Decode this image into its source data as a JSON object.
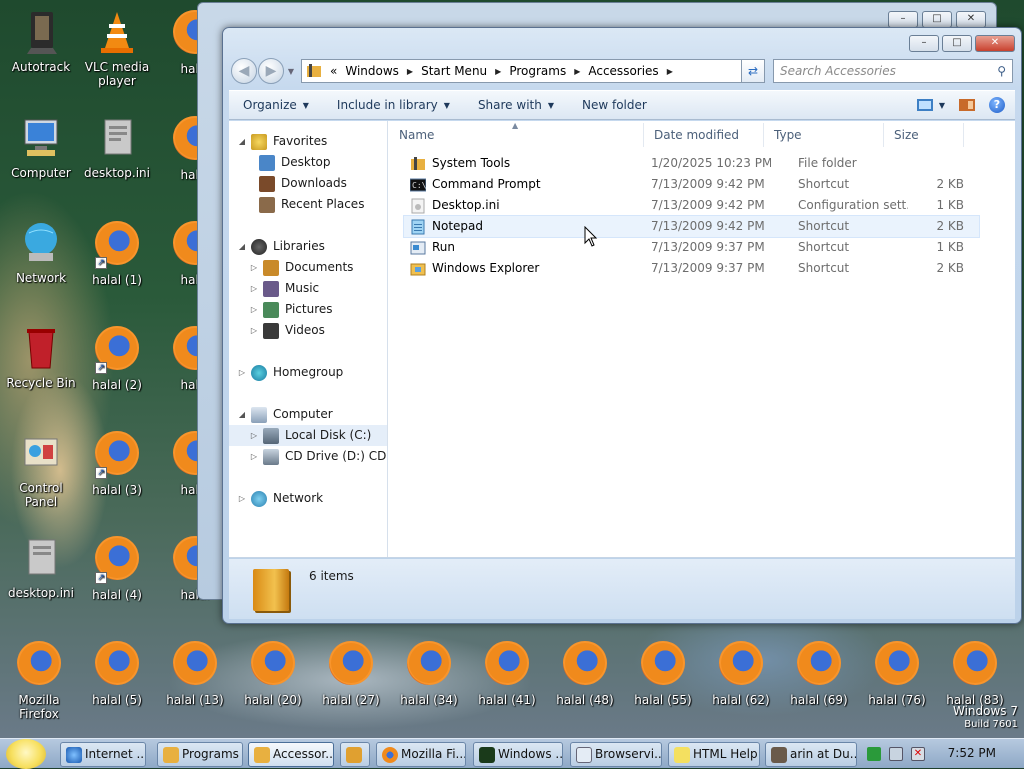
{
  "desktop": {
    "icons_left": [
      {
        "label": "Autotrack",
        "icon": "autotrack-icon"
      },
      {
        "label": "VLC media player",
        "icon": "vlc-cone-icon"
      },
      {
        "label": "Computer",
        "icon": "computer-icon"
      },
      {
        "label": "desktop.ini",
        "icon": "ini-file-icon"
      },
      {
        "label": "Network",
        "icon": "network-globe-icon"
      },
      {
        "label": "halal (1)",
        "icon": "firefox-icon"
      },
      {
        "label": "Recycle Bin",
        "icon": "recycle-bin-icon"
      },
      {
        "label": "halal (2)",
        "icon": "firefox-icon"
      },
      {
        "label": "Control Panel",
        "icon": "control-panel-icon"
      },
      {
        "label": "halal (3)",
        "icon": "firefox-icon"
      },
      {
        "label": "desktop.ini",
        "icon": "ini-file-icon"
      },
      {
        "label": "halal (4)",
        "icon": "firefox-icon"
      }
    ],
    "icons_col3": [
      "halal",
      "halal",
      "halal",
      "halal",
      "halal",
      "halal"
    ],
    "icons_bottom": [
      "Mozilla Firefox",
      "halal (5)",
      "halal (13)",
      "halal (20)",
      "halal (27)",
      "halal (34)",
      "halal (41)",
      "halal (48)",
      "halal (55)",
      "halal (62)",
      "halal (69)",
      "halal (76)",
      "halal (83)"
    ],
    "watermark": {
      "line1": "Windows 7",
      "line2": "Build 7601"
    }
  },
  "back_window": {
    "buttons": {
      "minimize": "–",
      "maximize": "□",
      "close": "✕"
    }
  },
  "explorer": {
    "caption_buttons": {
      "minimize": "–",
      "maximize": "□",
      "close": "✕"
    },
    "address": {
      "overflow": "«",
      "crumbs": [
        "Windows",
        "Start Menu",
        "Programs",
        "Accessories"
      ]
    },
    "search": {
      "placeholder": "Search Accessories"
    },
    "toolbar": {
      "organize": "Organize",
      "include_in_library": "Include in library",
      "share_with": "Share with",
      "new_folder": "New folder"
    },
    "nav_pane": {
      "favorites": {
        "label": "Favorites",
        "items": [
          "Desktop",
          "Downloads",
          "Recent Places"
        ]
      },
      "libraries": {
        "label": "Libraries",
        "items": [
          "Documents",
          "Music",
          "Pictures",
          "Videos"
        ]
      },
      "homegroup": "Homegroup",
      "computer": {
        "label": "Computer",
        "items": [
          "Local Disk (C:)",
          "CD Drive (D:) CDROM"
        ]
      },
      "network": "Network"
    },
    "columns": {
      "name": "Name",
      "date": "Date modified",
      "type": "Type",
      "size": "Size"
    },
    "files": [
      {
        "name": "System Tools",
        "date": "1/20/2025 10:23 PM",
        "type": "File folder",
        "size": "",
        "icon": "folder-icon"
      },
      {
        "name": "Command Prompt",
        "date": "7/13/2009 9:42 PM",
        "type": "Shortcut",
        "size": "2 KB",
        "icon": "cmd-icon"
      },
      {
        "name": "Desktop.ini",
        "date": "7/13/2009 9:42 PM",
        "type": "Configuration sett...",
        "size": "1 KB",
        "icon": "ini-file-icon"
      },
      {
        "name": "Notepad",
        "date": "7/13/2009 9:42 PM",
        "type": "Shortcut",
        "size": "2 KB",
        "icon": "notepad-icon"
      },
      {
        "name": "Run",
        "date": "7/13/2009 9:37 PM",
        "type": "Shortcut",
        "size": "1 KB",
        "icon": "run-icon"
      },
      {
        "name": "Windows Explorer",
        "date": "7/13/2009 9:37 PM",
        "type": "Shortcut",
        "size": "2 KB",
        "icon": "explorer-folder-icon"
      }
    ],
    "details": {
      "count": "6 items"
    }
  },
  "taskbar": {
    "buttons": [
      {
        "label": "Internet ...",
        "icon": "ie-icon"
      },
      {
        "label": "Programs",
        "icon": "folder-icon"
      },
      {
        "label": "Accessor...",
        "icon": "folder-icon"
      },
      {
        "label": "",
        "icon": "arrow-icon"
      },
      {
        "label": "Mozilla Fi...",
        "icon": "firefox-icon"
      },
      {
        "label": "Windows ...",
        "icon": "console-icon"
      },
      {
        "label": "Browservi...",
        "icon": "window-icon"
      },
      {
        "label": "HTML Help",
        "icon": "help-icon"
      },
      {
        "label": "arin at Du...",
        "icon": "chat-icon"
      }
    ],
    "clock": "7:52 PM"
  },
  "colors": {
    "accent": "#1f5ec8",
    "selection": "#eaf3fd"
  }
}
